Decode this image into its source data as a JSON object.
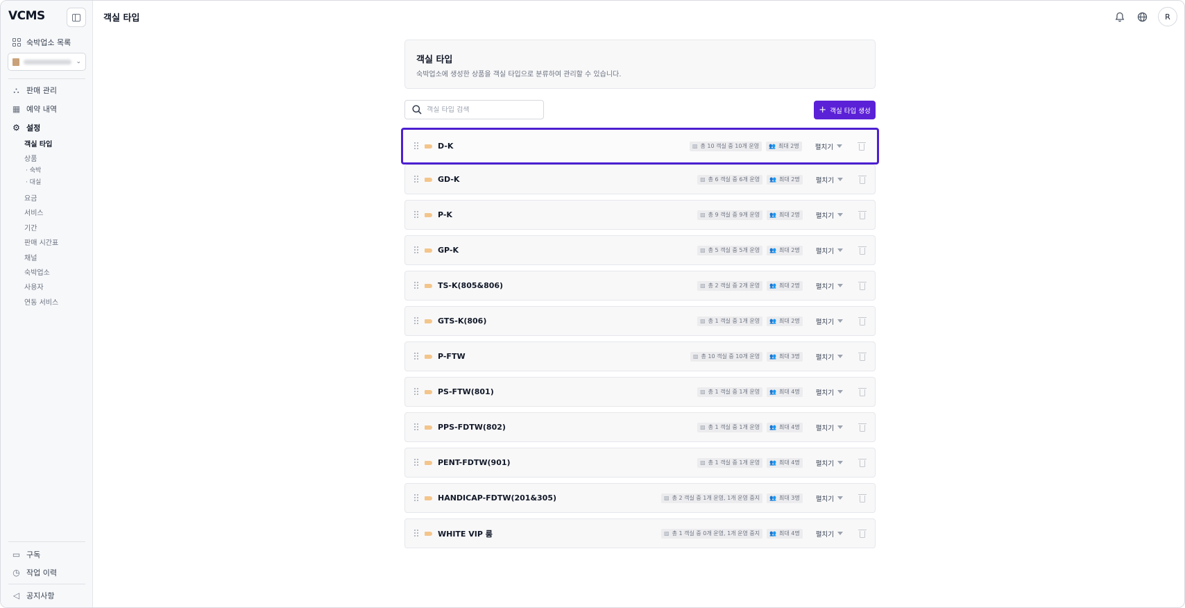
{
  "sidebar": {
    "logo": "VCMS",
    "property_list": "숙박업소 목록",
    "nav": {
      "sales": "판매 관리",
      "reservations": "예약 내역",
      "settings": "설정"
    },
    "settings_items": {
      "room_type": "객실 타입",
      "product": "상품",
      "product_stay": "숙박",
      "product_dayuse": "대실",
      "rate": "요금",
      "service": "서비스",
      "period": "기간",
      "sales_schedule": "판매 시간표",
      "channel": "채널",
      "property": "숙박업소",
      "user": "사용자",
      "integration": "연동 서비스"
    },
    "bottom": {
      "subscription": "구독",
      "work_history": "작업 이력",
      "notice": "공지사항"
    }
  },
  "header": {
    "title": "객실 타입",
    "avatar": "R"
  },
  "card": {
    "title": "객실 타입",
    "description": "숙박업소에 생성한 상품을 객실 타입으로 분류하여 관리할 수 있습니다."
  },
  "search": {
    "placeholder": "객실 타입 검색"
  },
  "create_button": "객실 타입 생성",
  "expand_label": "펼치기",
  "rooms": [
    {
      "name": "D-K",
      "rooms": "총 10 객실 중 10개 운영",
      "capacity": "최대 2명"
    },
    {
      "name": "GD-K",
      "rooms": "총 6 객실 중 6개 운영",
      "capacity": "최대 2명"
    },
    {
      "name": "P-K",
      "rooms": "총 9 객실 중 9개 운영",
      "capacity": "최대 2명"
    },
    {
      "name": "GP-K",
      "rooms": "총 5 객실 중 5개 운영",
      "capacity": "최대 2명"
    },
    {
      "name": "TS-K(805&806)",
      "rooms": "총 2 객실 중 2개 운영",
      "capacity": "최대 2명"
    },
    {
      "name": "GTS-K(806)",
      "rooms": "총 1 객실 중 1개 운영",
      "capacity": "최대 2명"
    },
    {
      "name": "P-FTW",
      "rooms": "총 10 객실 중 10개 운영",
      "capacity": "최대 3명"
    },
    {
      "name": "PS-FTW(801)",
      "rooms": "총 1 객실 중 1개 운영",
      "capacity": "최대 4명"
    },
    {
      "name": "PPS-FDTW(802)",
      "rooms": "총 1 객실 중 1개 운영",
      "capacity": "최대 4명"
    },
    {
      "name": "PENT-FDTW(901)",
      "rooms": "총 1 객실 중 1개 운영",
      "capacity": "최대 4명"
    },
    {
      "name": "HANDICAP-FDTW(201&305)",
      "rooms": "총 2 객실 중 1개 운영, 1개 운영 중지",
      "capacity": "최대 3명"
    },
    {
      "name": "WHITE VIP 룸",
      "rooms": "총 1 객실 중 0개 운영, 1개 운영 중지",
      "capacity": "최대 4명"
    }
  ],
  "colors": {
    "accent": "#5b21d6",
    "selected_border": "#4c1fd0",
    "tag": "#f3c58b"
  }
}
